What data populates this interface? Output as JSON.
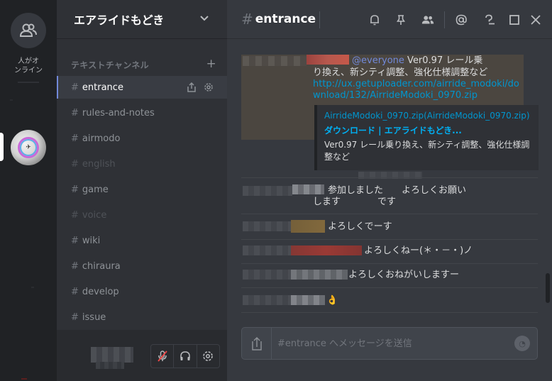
{
  "rail": {
    "online_label": "人がオ\nンライン"
  },
  "sidebar": {
    "guild_name": "エアライドもどき",
    "category": "テキストチャンネル",
    "channels": [
      {
        "name": "entrance"
      },
      {
        "name": "rules-and-notes"
      },
      {
        "name": "airmodo"
      },
      {
        "name": "english"
      },
      {
        "name": "game"
      },
      {
        "name": "voice"
      },
      {
        "name": "wiki"
      },
      {
        "name": "chiraura"
      },
      {
        "name": "develop"
      },
      {
        "name": "issue"
      }
    ]
  },
  "header": {
    "hash": "#",
    "channel": "entrance"
  },
  "messages": {
    "m1": {
      "mention": "@everyone",
      "line1": " Ver0.97 レール乗",
      "line2": "り換え、新シティ調整、強化仕様調整など",
      "link1": "http://ux.getuploader.com/airride_modoki/do",
      "link2": "wnload/132/AirrideModoki_0970.zip"
    },
    "embed": {
      "provider": "AirrideModoki_0970.zip(AirrideModoki_0970.zip)",
      "title": "ダウンロード | エアライドもどき...",
      "desc": "Ver0.97 レール乗り換え、新シティ調整、強化仕様調整など"
    },
    "m2a": "参加しました　　よろしくお願い",
    "m2b": "します　　　　です",
    "m3": "よろしくでーす",
    "m4": "よろしくねー(＊・－・)ノ",
    "m5": "よろしくおねがいしますー",
    "m6": "👌"
  },
  "composer": {
    "placeholder": "#entrance へメッセージを送信"
  },
  "colors": {
    "accent": "#7289da",
    "link": "#0096cf",
    "mention_bg": "#4b4640"
  }
}
